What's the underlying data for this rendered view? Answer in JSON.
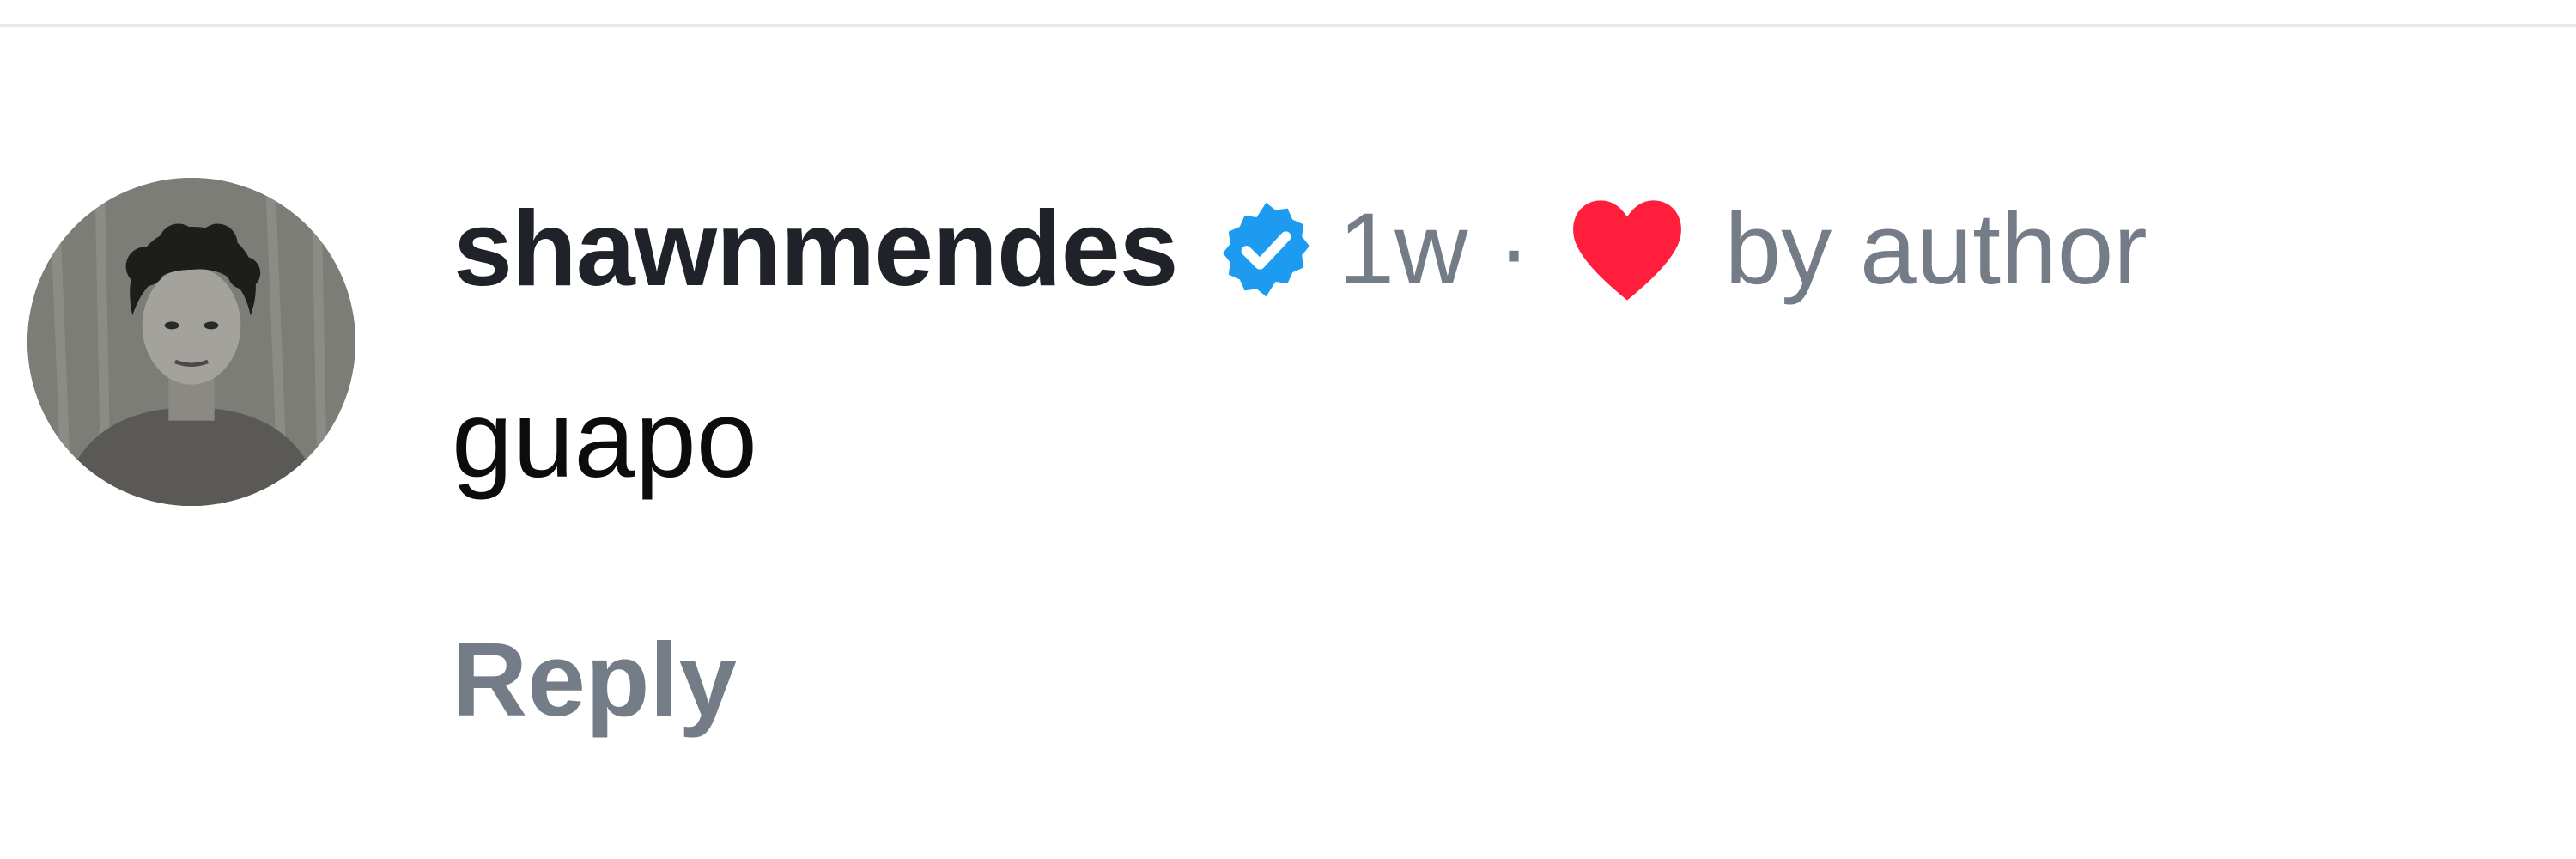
{
  "comment": {
    "username": "shawnmendes",
    "verified_icon": "verified-badge-icon",
    "timestamp": "1w",
    "separator": "·",
    "liked_icon": "heart-icon",
    "liked_by_label": "by author",
    "text": "guapo",
    "reply_label": "Reply"
  },
  "colors": {
    "verified": "#1d9bf0",
    "heart": "#ff1f3d",
    "muted_text": "#737c87",
    "username_text": "#1f2329"
  }
}
